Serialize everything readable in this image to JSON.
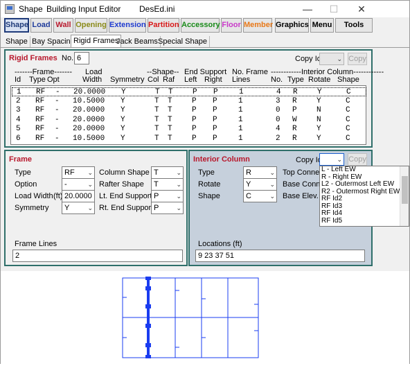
{
  "window": {
    "title_app": "Shape",
    "title_editor": "Building Input Editor",
    "title_file": "DesEd.ini",
    "minimize": "—",
    "maximize": "☐",
    "close": "✕"
  },
  "toolbar": [
    {
      "label": "Shape",
      "color": "#1f3b7a"
    },
    {
      "label": "Load",
      "color": "#1f3b9a"
    },
    {
      "label": "Wall",
      "color": "#b8182c"
    },
    {
      "label": "Opening",
      "color": "#8a8a18"
    },
    {
      "label": "Extension",
      "color": "#1f3bcf"
    },
    {
      "label": "Partition",
      "color": "#d81818"
    },
    {
      "label": "Accessory",
      "color": "#188a18"
    },
    {
      "label": "Floor",
      "color": "#c838c8"
    },
    {
      "label": "Member",
      "color": "#e87818"
    },
    {
      "label": "Graphics",
      "color": "#000000"
    },
    {
      "label": "Menu",
      "color": "#000000"
    },
    {
      "label": "Tools",
      "color": "#000000"
    }
  ],
  "subtabs": [
    "Shape",
    "Bay Spacing",
    "Rigid Frames",
    "Jack Beams",
    "Special Shape"
  ],
  "rigid_frames": {
    "title": "Rigid Frames",
    "no_label": "No.",
    "no_value": "6",
    "copy_id_label": "Copy Id",
    "copy_button": "Copy",
    "headers": {
      "frame_group": "-------Frame-------",
      "id": "Id",
      "type": "Type",
      "opt": "Opt",
      "load": "Load",
      "width": "Width",
      "symmetry": "Symmetry",
      "shape_group": "--Shape--",
      "col": "Col",
      "raf": "Raf",
      "end_support": "End Support",
      "left": "Left",
      "right": "Right",
      "no_frame": "No. Frame",
      "lines": "Lines",
      "interior_group": "------------Interior Column------------",
      "no": "No.",
      "itype": "Type",
      "rotate": "Rotate",
      "shape": "Shape"
    },
    "rows": [
      [
        "1",
        "RF",
        "-",
        "20.0000",
        "Y",
        "T",
        "T",
        "P",
        "P",
        "1",
        "4",
        "R",
        "Y",
        "C"
      ],
      [
        "2",
        "RF",
        "-",
        "10.5000",
        "Y",
        "T",
        "T",
        "P",
        "P",
        "1",
        "3",
        "R",
        "Y",
        "C"
      ],
      [
        "3",
        "RF",
        "-",
        "20.0000",
        "Y",
        "T",
        "T",
        "P",
        "P",
        "1",
        "0",
        "P",
        "N",
        "C"
      ],
      [
        "4",
        "RF",
        "-",
        "20.0000",
        "Y",
        "T",
        "T",
        "P",
        "P",
        "1",
        "0",
        "W",
        "N",
        "C"
      ],
      [
        "5",
        "RF",
        "-",
        "20.0000",
        "Y",
        "T",
        "T",
        "P",
        "P",
        "1",
        "4",
        "R",
        "Y",
        "C"
      ],
      [
        "6",
        "RF",
        "-",
        "10.5000",
        "Y",
        "T",
        "T",
        "P",
        "P",
        "1",
        "2",
        "R",
        "Y",
        "C"
      ]
    ]
  },
  "frame": {
    "title": "Frame",
    "type_label": "Type",
    "type_value": "RF",
    "option_label": "Option",
    "option_value": "-",
    "load_width_label": "Load Width",
    "load_width_unit": "(ft)",
    "load_width_value": "20.0000",
    "symmetry_label": "Symmetry",
    "symmetry_value": "Y",
    "column_shape_label": "Column Shape",
    "column_shape_value": "T",
    "rafter_shape_label": "Rafter Shape",
    "rafter_shape_value": "T",
    "lt_end_label": "Lt. End Support",
    "lt_end_value": "P",
    "rt_end_label": "Rt. End Support",
    "rt_end_value": "P",
    "frame_lines_label": "Frame Lines",
    "frame_lines_value": "2"
  },
  "interior": {
    "title": "Interior Column",
    "copy_id_label": "Copy Id",
    "copy_button": "Copy",
    "type_label": "Type",
    "type_value": "R",
    "rotate_label": "Rotate",
    "rotate_value": "Y",
    "shape_label": "Shape",
    "shape_value": "C",
    "top_connect_label": "Top Connect",
    "base_connect_label": "Base Connect",
    "base_elev_label": "Base Elev.",
    "locations_label": "Locations (ft)",
    "locations_value": "9 23 37 51",
    "dropdown_options": [
      "L - Left EW",
      "R - Right EW",
      "L2 - Outermost Left EW",
      "R2 - Outermost Right EW",
      "RF Id2",
      "RF Id3",
      "RF Id4",
      "RF Id5"
    ]
  },
  "colors": {
    "panel_border": "#2f6f6a",
    "panel_title": "#b8182c",
    "interior_bg": "#c6d0dc",
    "drawing_blue": "#1a3cf0"
  },
  "icons": {
    "app": "app-icon",
    "dropdown": "chevron-down-icon"
  }
}
